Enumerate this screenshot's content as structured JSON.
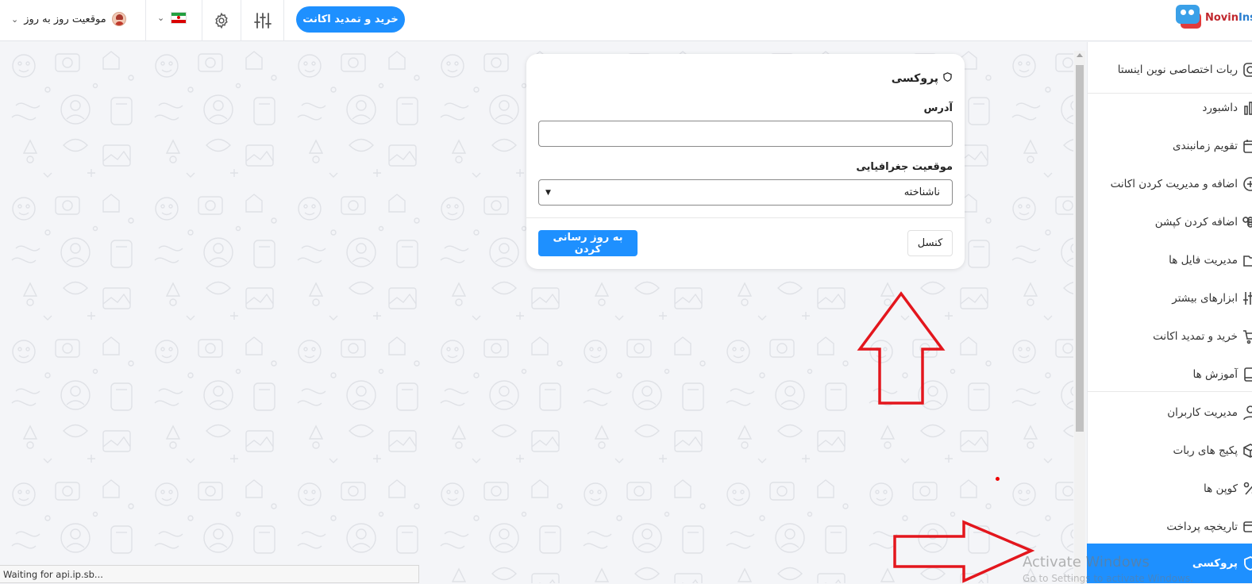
{
  "topbar": {
    "status_text": "موقعیت روز به روز",
    "buy_button": "خرید و تمدید اکانت",
    "logo_text_a": "Novin",
    "logo_text_b": "Ins"
  },
  "sidebar": {
    "items": [
      {
        "label": "ربات اختصاصی نوین اینستا",
        "icon": "instagram-icon"
      },
      {
        "label": "داشبورد",
        "icon": "chart-bars-icon"
      },
      {
        "label": "تقویم زمانبندی",
        "icon": "calendar-icon"
      },
      {
        "label": "اضافه و مدیریت کردن اکانت",
        "icon": "plus-circle-icon"
      },
      {
        "label": "اضافه کردن کپشن",
        "icon": "command-icon"
      },
      {
        "label": "مدیریت فایل ها",
        "icon": "folder-icon"
      },
      {
        "label": "ابزارهای بیشتر",
        "icon": "sliders-icon"
      },
      {
        "label": "خرید و تمدید اکانت",
        "icon": "cart-icon"
      },
      {
        "label": "آموزش ها",
        "icon": "book-icon"
      },
      {
        "label": "مدیریت کاربران",
        "icon": "user-icon"
      },
      {
        "label": "پکیج های ربات",
        "icon": "package-icon"
      },
      {
        "label": "کوپن ها",
        "icon": "percent-icon"
      },
      {
        "label": "تاریخچه پرداخت",
        "icon": "credit-card-icon"
      },
      {
        "label": "پروکسی",
        "icon": "shield-icon",
        "active": true
      }
    ]
  },
  "proxy_card": {
    "title": "پروکسی",
    "address_label": "آدرس",
    "address_value": "",
    "location_label": "موقعیت جغرافیایی",
    "location_value": "ناشناخته",
    "update_button": "به روز رسانی کردن",
    "cancel_button": "کنسل"
  },
  "statusbar": {
    "text": "Waiting for api.ip.sb..."
  },
  "os_watermark": {
    "line1": "Activate Windows",
    "line2": "Go to Settings to activate Windows."
  },
  "colors": {
    "accent": "#1e90ff",
    "annotation": "#e3161d"
  }
}
